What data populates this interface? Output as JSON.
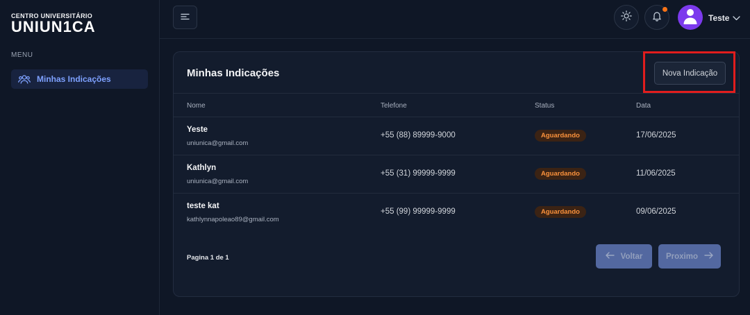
{
  "brand": {
    "subtitle": "CENTRO UNIVERSITÁRIO",
    "logo": "UNIUN1CA"
  },
  "sidebar": {
    "menu_label": "MENU",
    "items": [
      {
        "label": "Minhas Indicações",
        "icon": "users-icon",
        "active": true
      }
    ]
  },
  "header": {
    "user_name": "Teste",
    "notification_dot_color": "#f97316",
    "avatar_color": "#7c3aed"
  },
  "card": {
    "title": "Minhas Indicações",
    "new_button_label": "Nova Indicação",
    "columns": [
      "Nome",
      "Telefone",
      "Status",
      "Data"
    ],
    "rows": [
      {
        "name": "Yeste",
        "email": "uniunica@gmail.com",
        "phone": "+55 (88) 89999-9000",
        "status": "Aguardando",
        "date": "17/06/2025"
      },
      {
        "name": "Kathlyn",
        "email": "uniunica@gmail.com",
        "phone": "+55 (31) 99999-9999",
        "status": "Aguardando",
        "date": "11/06/2025"
      },
      {
        "name": "teste kat",
        "email": "kathlynnapoleao89@gmail.com",
        "phone": "+55 (99) 99999-9999",
        "status": "Aguardando",
        "date": "09/06/2025"
      }
    ],
    "pagination": {
      "info": "Pagina 1 de 1",
      "back_label": "Voltar",
      "next_label": "Proximo"
    }
  },
  "colors": {
    "accent": "#7ea1ff",
    "status_text": "#fb923c",
    "status_bg": "#3b2314",
    "highlight": "#e11d1d"
  }
}
